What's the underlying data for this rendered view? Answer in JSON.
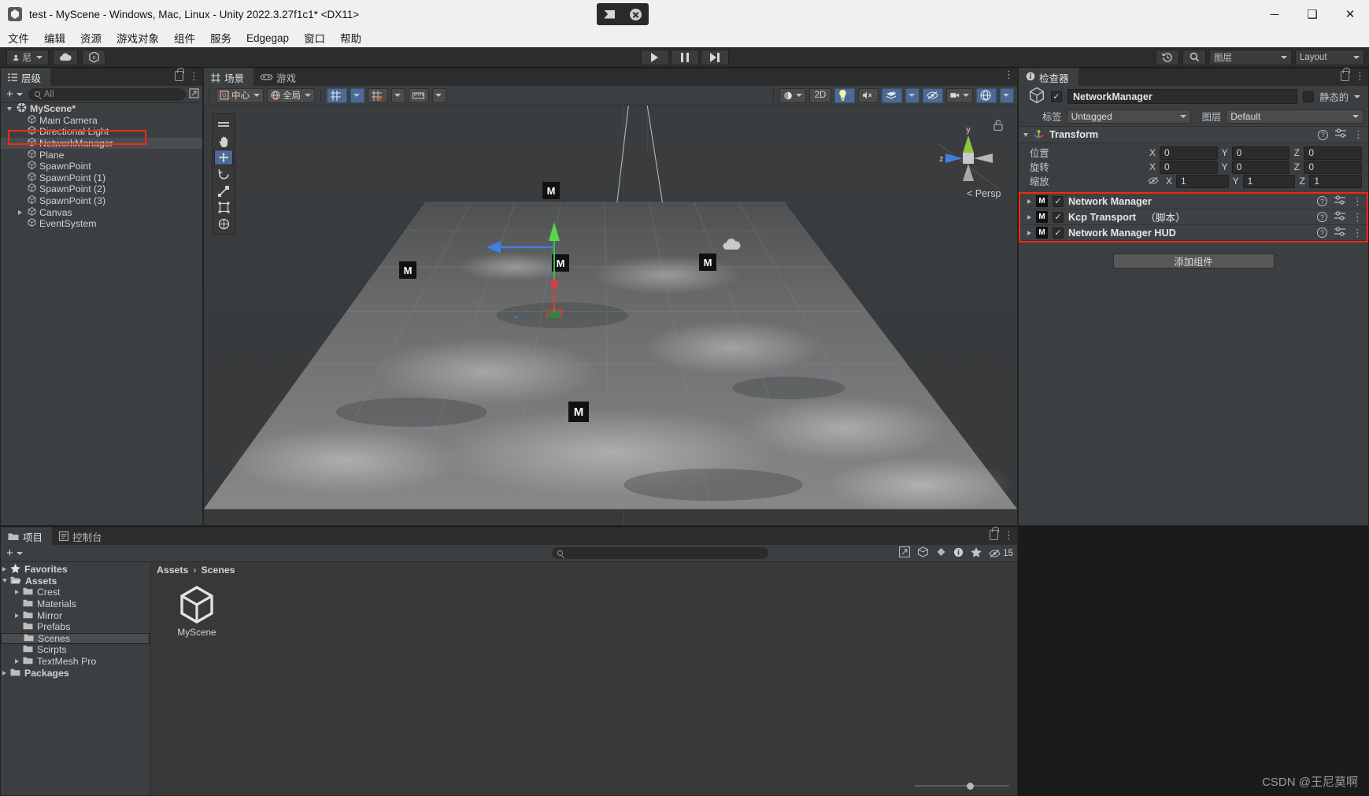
{
  "window": {
    "title": "test - MyScene - Windows, Mac, Linux - Unity 2022.3.27f1c1* <DX11>",
    "app_icon": "unity-icon",
    "minimize": "─",
    "maximize": "❑",
    "close": "✕"
  },
  "menubar": {
    "items": [
      "文件",
      "编辑",
      "资源",
      "游戏对象",
      "组件",
      "服务",
      "Edgegap",
      "窗口",
      "帮助"
    ]
  },
  "toolbar": {
    "account_label": "尼",
    "cloud_icon": "cloud-icon",
    "services_icon": "unity-services-icon",
    "play": "play-icon",
    "pause": "pause-icon",
    "step": "step-icon",
    "undo_history_icon": "undo-history-icon",
    "search_icon": "search-icon",
    "layers_label": "图层",
    "layout_label": "Layout"
  },
  "hierarchy": {
    "tab_label": "层级",
    "add_label": "+",
    "search_placeholder": "All",
    "items": [
      {
        "label": "MyScene*",
        "depth": 0,
        "icon": "scene-icon",
        "expanded": true,
        "selected": false
      },
      {
        "label": "Main Camera",
        "depth": 1,
        "icon": "gameobject-icon",
        "expanded": null,
        "selected": false
      },
      {
        "label": "Directional Light",
        "depth": 1,
        "icon": "gameobject-icon",
        "expanded": null,
        "selected": false
      },
      {
        "label": "NetworkManager",
        "depth": 1,
        "icon": "gameobject-icon",
        "expanded": null,
        "selected": true
      },
      {
        "label": "Plane",
        "depth": 1,
        "icon": "gameobject-icon",
        "expanded": null,
        "selected": false
      },
      {
        "label": "SpawnPoint",
        "depth": 1,
        "icon": "gameobject-icon",
        "expanded": null,
        "selected": false
      },
      {
        "label": "SpawnPoint (1)",
        "depth": 1,
        "icon": "gameobject-icon",
        "expanded": null,
        "selected": false
      },
      {
        "label": "SpawnPoint (2)",
        "depth": 1,
        "icon": "gameobject-icon",
        "expanded": null,
        "selected": false
      },
      {
        "label": "SpawnPoint (3)",
        "depth": 1,
        "icon": "gameobject-icon",
        "expanded": null,
        "selected": false
      },
      {
        "label": "Canvas",
        "depth": 1,
        "icon": "gameobject-icon",
        "expanded": false,
        "selected": false
      },
      {
        "label": "EventSystem",
        "depth": 1,
        "icon": "gameobject-icon",
        "expanded": null,
        "selected": false
      }
    ]
  },
  "sceneview": {
    "tabs": [
      {
        "label": "场景",
        "icon": "scene-grid-icon",
        "active": true
      },
      {
        "label": "游戏",
        "icon": "gamepad-icon",
        "active": false
      }
    ],
    "pivot_label": "中心",
    "handle_label": "全局",
    "grid_label": "grid-snap-icon",
    "snap_label": "snap-increment-icon",
    "ruler_label": "ruler-icon",
    "right_controls": {
      "shading": "shading-icon",
      "twod": "2D",
      "lighting": "lighting-icon",
      "audio": "audio-mute-icon",
      "fx": "effects-icon",
      "hidden": "visibility-icon",
      "camera": "scene-camera-icon",
      "gizmos": "gizmos-icon"
    },
    "gizmo_axis": {
      "y": "y",
      "z": "z",
      "persp": "Persp"
    },
    "tools": [
      "hand-tool",
      "move-tool",
      "rotate-tool",
      "scale-tool",
      "rect-tool",
      "transform-tool"
    ],
    "active_tool": "move-tool"
  },
  "inspector": {
    "tab_label": "检查器",
    "object_name": "NetworkManager",
    "enabled": true,
    "static_label": "静态的",
    "tag_label": "标签",
    "tag_value": "Untagged",
    "layer_label": "图层",
    "layer_value": "Default",
    "transform": {
      "title": "Transform",
      "rows": [
        {
          "label": "位置",
          "x": "0",
          "y": "0",
          "z": "0",
          "lock": false
        },
        {
          "label": "旋转",
          "x": "0",
          "y": "0",
          "z": "0",
          "lock": false
        },
        {
          "label": "缩放",
          "x": "1",
          "y": "1",
          "z": "1",
          "lock": true
        }
      ],
      "axis_x": "X",
      "axis_y": "Y",
      "axis_z": "Z"
    },
    "components": [
      {
        "name": "Network Manager",
        "icon": "mirror-icon",
        "enabled": true,
        "suffix": ""
      },
      {
        "name": "Kcp Transport",
        "icon": "mirror-icon",
        "enabled": true,
        "suffix": "（脚本）"
      },
      {
        "name": "Network Manager HUD",
        "icon": "mirror-icon",
        "enabled": true,
        "suffix": ""
      }
    ],
    "add_component_label": "添加组件",
    "highlight_color": "#f02a10"
  },
  "project": {
    "tabs": [
      {
        "label": "项目",
        "icon": "folder-icon",
        "active": true
      },
      {
        "label": "控制台",
        "icon": "console-icon",
        "active": false
      }
    ],
    "add_label": "+",
    "search_placeholder": "",
    "badge_count": "15",
    "breadcrumb": [
      "Assets",
      "Scenes"
    ],
    "breadcrumb_sep": "›",
    "tree": [
      {
        "label": "Favorites",
        "depth": 0,
        "icon": "star-icon",
        "expanded": false,
        "selected": false
      },
      {
        "label": "Assets",
        "depth": 0,
        "icon": "folder-open-icon",
        "expanded": true,
        "selected": false
      },
      {
        "label": "Crest",
        "depth": 1,
        "icon": "folder-icon",
        "expanded": false,
        "selected": false
      },
      {
        "label": "Materials",
        "depth": 1,
        "icon": "folder-icon",
        "expanded": null,
        "selected": false
      },
      {
        "label": "Mirror",
        "depth": 1,
        "icon": "folder-icon",
        "expanded": false,
        "selected": false
      },
      {
        "label": "Prefabs",
        "depth": 1,
        "icon": "folder-icon",
        "expanded": null,
        "selected": false
      },
      {
        "label": "Scenes",
        "depth": 1,
        "icon": "folder-icon",
        "expanded": null,
        "selected": true
      },
      {
        "label": "Scirpts",
        "depth": 1,
        "icon": "folder-icon",
        "expanded": null,
        "selected": false
      },
      {
        "label": "TextMesh Pro",
        "depth": 1,
        "icon": "folder-icon",
        "expanded": false,
        "selected": false
      },
      {
        "label": "Packages",
        "depth": 0,
        "icon": "folder-icon",
        "expanded": false,
        "selected": false
      }
    ],
    "assets": [
      {
        "name": "MyScene",
        "icon": "unity-scene-icon"
      }
    ]
  },
  "watermark": "CSDN @王尼莫啊"
}
